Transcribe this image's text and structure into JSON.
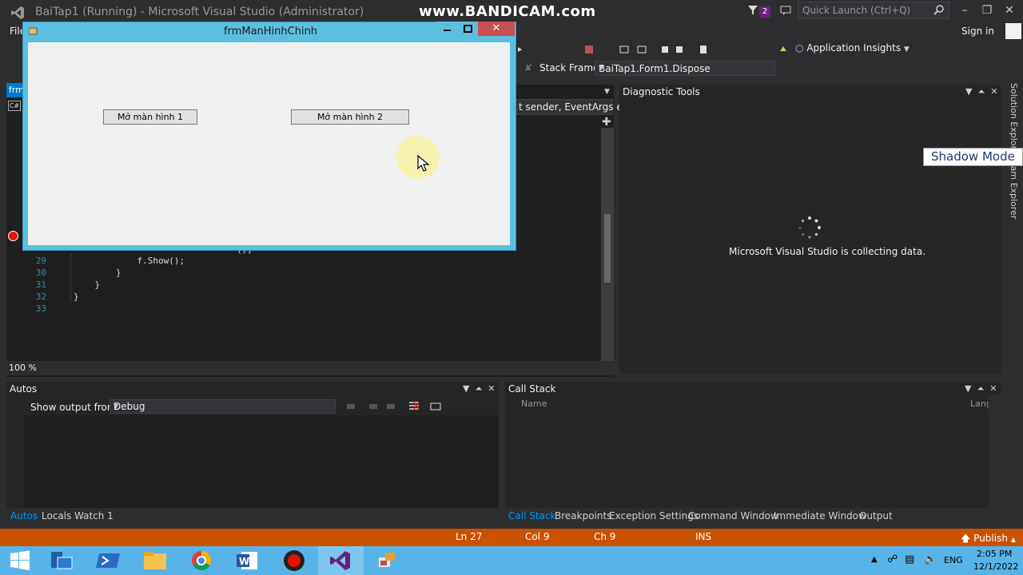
{
  "window": {
    "title": "BaiTap1 (Running) - Microsoft Visual Studio (Administrator)",
    "watermark": "www.BANDICAM.com",
    "notification_count": "2",
    "quick_launch_placeholder": "Quick Launch (Ctrl+Q)",
    "sign_in": "Sign in"
  },
  "menu": {
    "file": "File"
  },
  "toolbar": {
    "app_insights": "Application Insights",
    "stack_frame_label": "Stack Frame:",
    "stack_frame_value": "BaiTap1.Form1.Dispose"
  },
  "editor": {
    "tab_label": "frm",
    "nav_dropdown": "t sender, EventArgs e)",
    "zoom": "100 %",
    "lines": [
      {
        "num": "29",
        "text": "            f.Show();"
      },
      {
        "num": "30",
        "text": "        }"
      },
      {
        "num": "31",
        "text": "    }"
      },
      {
        "num": "32",
        "text": "}"
      },
      {
        "num": "33",
        "text": ""
      }
    ],
    "partial_text": "();"
  },
  "diagnostic": {
    "title": "Diagnostic Tools",
    "message": "Microsoft Visual Studio is collecting data."
  },
  "side_tabs": {
    "solution_explorer": "Solution Explorer",
    "team_explorer": "Team Explorer"
  },
  "shadow_mode": "Shadow Mode",
  "autos": {
    "title": "Autos",
    "show_output_from": "Show output from:",
    "output_source": "Debug",
    "tabs": [
      "Autos",
      "Locals",
      "Watch 1"
    ]
  },
  "callstack": {
    "title": "Call Stack",
    "col_name": "Name",
    "col_lang": "Lang",
    "tabs": [
      "Call Stack",
      "Breakpoints",
      "Exception Settings",
      "Command Window",
      "Immediate Window",
      "Output"
    ]
  },
  "status": {
    "ln": "Ln 27",
    "col": "Col 9",
    "ch": "Ch 9",
    "ins": "INS",
    "publish": "Publish"
  },
  "taskbar": {
    "lang": "ENG",
    "time": "2:05 PM",
    "date": "12/1/2022"
  },
  "form": {
    "title": "frmManHinhChinh",
    "button1": "Mở màn hình 1",
    "button2": "Mở màn hình 2"
  },
  "colors": {
    "accent": "#007acc",
    "status_bar": "#ca5100",
    "taskbar": "#58b4e8",
    "form_chrome": "#5bc0de"
  }
}
